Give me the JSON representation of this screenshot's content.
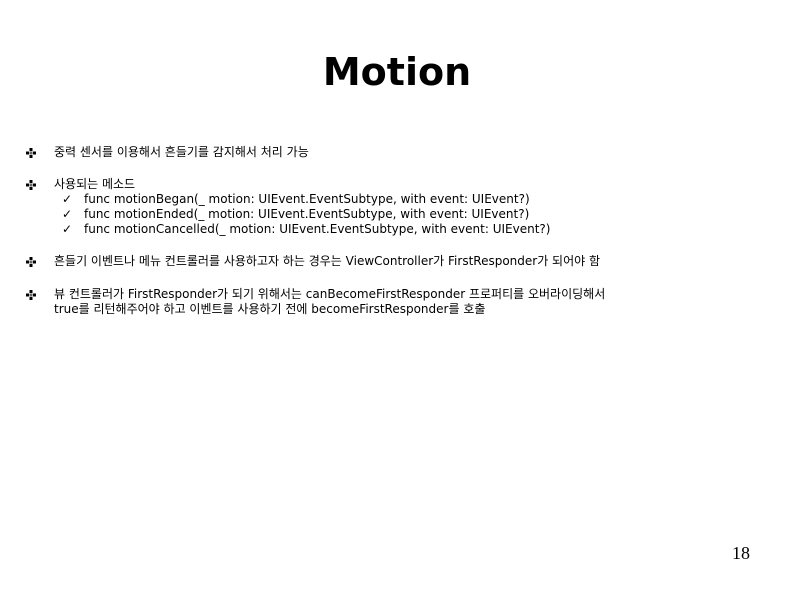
{
  "slide": {
    "title": "Motion",
    "page_number": "18",
    "bullets": [
      {
        "icon": "diamond-bullet-icon",
        "lines": [
          "중력 센서를 이용해서 흔들기를 감지해서 처리 가능"
        ]
      },
      {
        "icon": "diamond-bullet-icon",
        "lines": [
          "사용되는 메소드"
        ],
        "sub_items": [
          {
            "icon": "checkmark-icon",
            "check": "✓",
            "text": "func motionBegan(_ motion: UIEvent.EventSubtype, with event: UIEvent?)"
          },
          {
            "icon": "checkmark-icon",
            "check": "✓",
            "text": "func motionEnded(_ motion: UIEvent.EventSubtype, with event: UIEvent?)"
          },
          {
            "icon": "checkmark-icon",
            "check": "✓",
            "text": "func motionCancelled(_ motion: UIEvent.EventSubtype, with event: UIEvent?)"
          }
        ]
      },
      {
        "icon": "diamond-bullet-icon",
        "lines": [
          "흔들기 이벤트나 메뉴 컨트롤러를 사용하고자 하는 경우는 ViewController가 FirstResponder가 되어야 함"
        ]
      },
      {
        "icon": "diamond-bullet-icon",
        "lines": [
          "뷰 컨트롤러가 FirstResponder가 되기 위해서는 canBecomeFirstResponder 프로퍼티를 오버라이딩해서",
          "true를 리턴해주어야 하고 이벤트를 사용하기 전에 becomeFirstResponder를 호출"
        ]
      }
    ]
  }
}
